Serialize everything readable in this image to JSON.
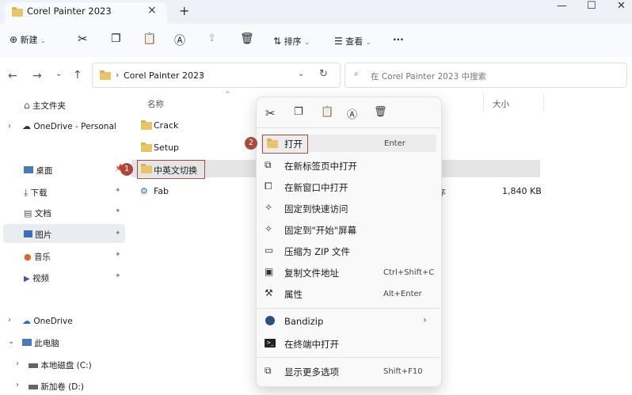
{
  "tab": {
    "title": "Corel Painter 2023",
    "close": "×",
    "new_tab": "+"
  },
  "window_controls": {
    "minimize": "—",
    "maximize": "☐",
    "close": "✕"
  },
  "toolbar": {
    "new_label": "新建",
    "sort_label": "排序",
    "view_label": "查看",
    "more_label": "···"
  },
  "address": {
    "folder": "Corel Painter 2023",
    "sep1": "›",
    "sep2": "›"
  },
  "search": {
    "placeholder": "在 Corel Painter 2023 中搜索"
  },
  "nav": {
    "home": "主文件夹",
    "onedrive_personal": "OneDrive - Personal",
    "desktop": "桌面",
    "downloads": "下载",
    "documents": "文档",
    "pictures": "图片",
    "music": "音乐",
    "videos": "视频",
    "onedrive": "OneDrive",
    "this_pc": "此电脑",
    "drive_c": "本地磁盘 (C:)",
    "drive_d": "新加卷 (D:)"
  },
  "columns": {
    "name": "名称",
    "size": "大小"
  },
  "files": [
    {
      "name": "Crack",
      "size": ""
    },
    {
      "name": "Setup",
      "size": ""
    },
    {
      "name": "中英文切换",
      "size": ""
    },
    {
      "name": "Fab",
      "type_fragment": "序",
      "size": "1,840 KB"
    }
  ],
  "badges": {
    "one": "1",
    "two": "2"
  },
  "context_menu": {
    "open": {
      "label": "打开",
      "shortcut": "Enter"
    },
    "open_new_tab": "在新标签页中打开",
    "open_new_window": "在新窗口中打开",
    "pin_quick": "固定到快速访问",
    "pin_start": "固定到\"开始\"屏幕",
    "compress_zip": "压缩为 ZIP 文件",
    "copy_path": {
      "label": "复制文件地址",
      "shortcut": "Ctrl+Shift+C"
    },
    "properties": {
      "label": "属性",
      "shortcut": "Alt+Enter"
    },
    "bandizip": "Bandizip",
    "open_terminal": "在终端中打开",
    "more_options": {
      "label": "显示更多选项",
      "shortcut": "Shift+F10"
    }
  },
  "colors": {
    "accent": "#a64a3c",
    "folder": "#e8c56a"
  }
}
